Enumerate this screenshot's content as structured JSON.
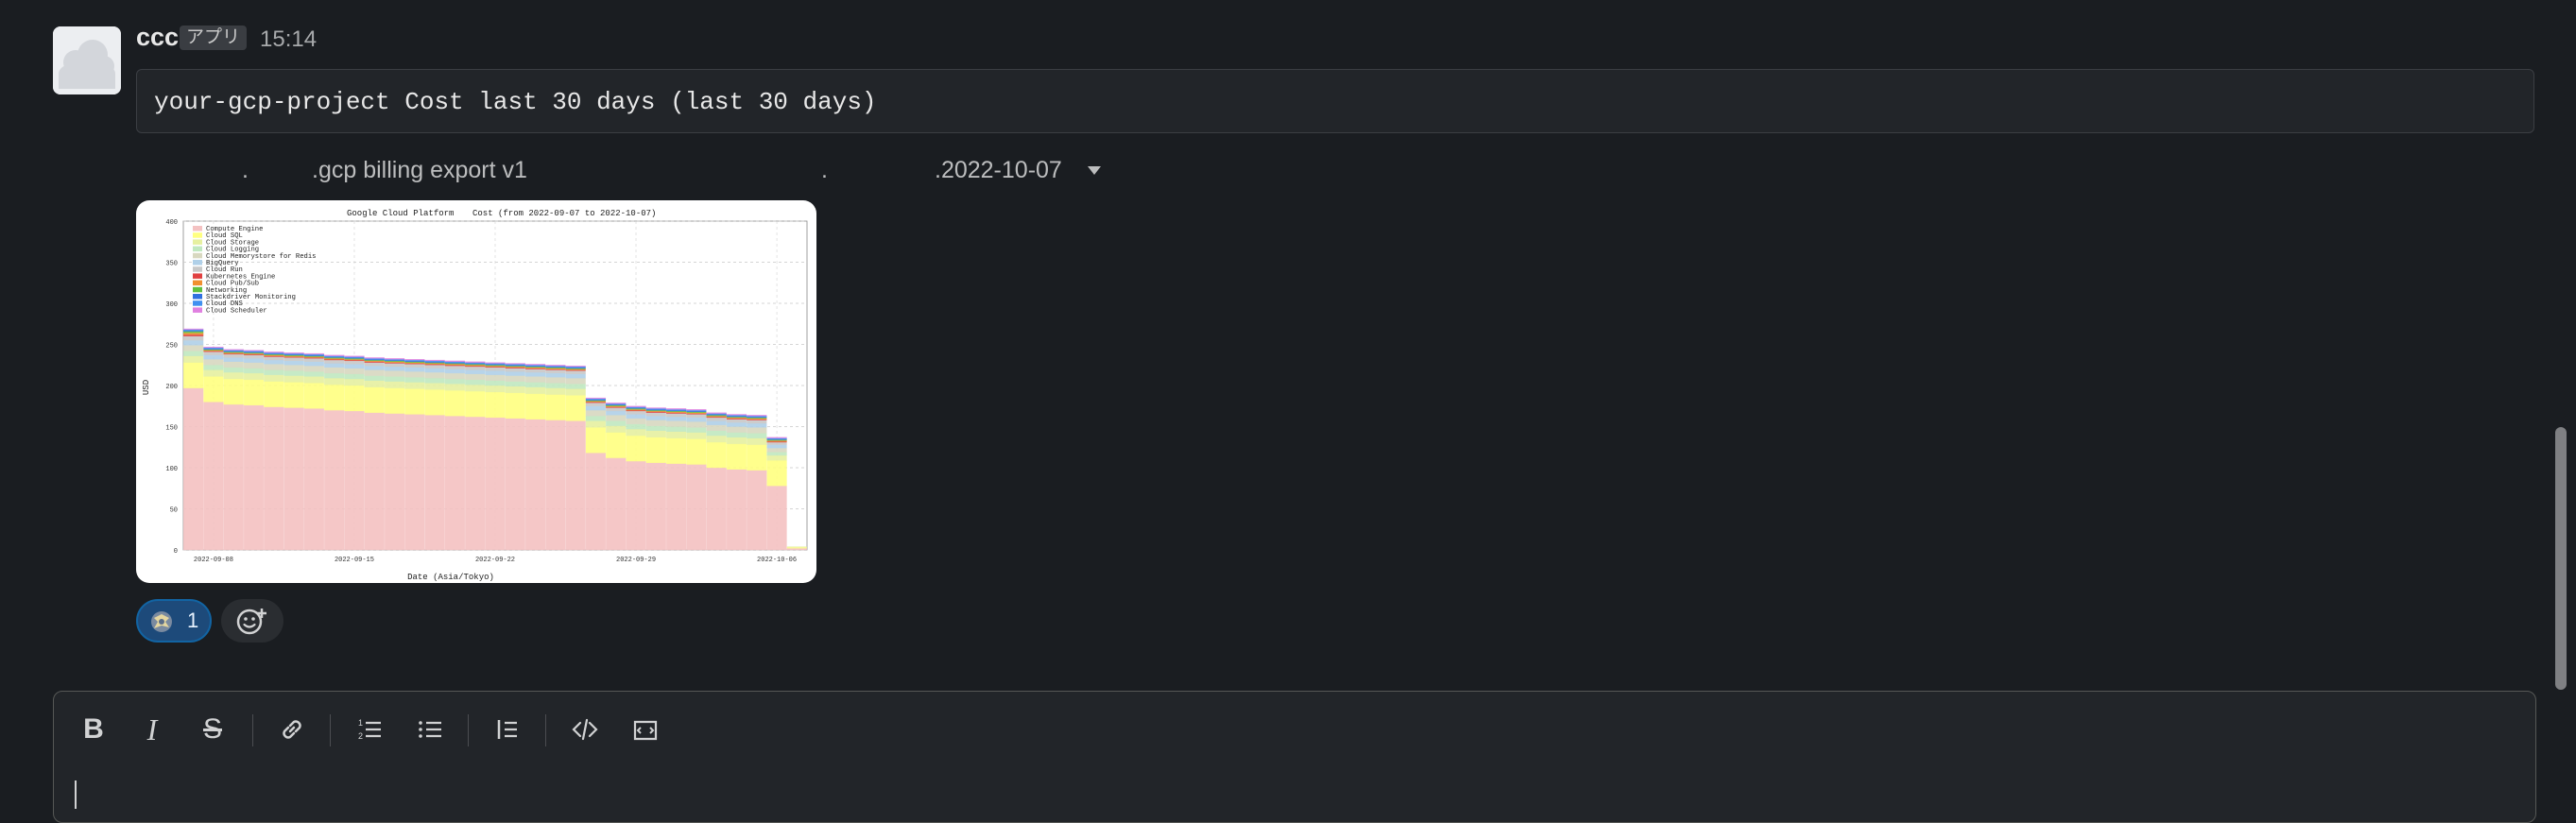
{
  "message": {
    "sender": "ccc",
    "app_badge": "アプリ",
    "time": "15:14",
    "code_text": "your-gcp-project Cost last 30 days (last 30 days)",
    "attachment": {
      "parts": [
        ".",
        ".gcp billing export v1",
        ".",
        ".2022-10-07"
      ],
      "dropdown_icon": "caret-down-icon"
    },
    "reaction": {
      "emoji": "custom-emoji",
      "count": "1"
    },
    "add_reaction_icon": "add-reaction-icon"
  },
  "chart_data": {
    "type": "bar",
    "title": "Google Cloud Platform",
    "subtitle": "Cost (from 2022-09-07 to 2022-10-07)",
    "xlabel": "Date (Asia/Tokyo)",
    "ylabel": "USD",
    "ylim": [
      0,
      400
    ],
    "yticks": [
      0,
      50,
      100,
      150,
      200,
      250,
      300,
      350,
      400
    ],
    "xticks": [
      "2022-09-08",
      "2022-09-15",
      "2022-09-22",
      "2022-09-29",
      "2022-10-06"
    ],
    "legend_position": "top-left",
    "grid": true,
    "categories": [
      "2022-09-07",
      "2022-09-08",
      "2022-09-09",
      "2022-09-10",
      "2022-09-11",
      "2022-09-12",
      "2022-09-13",
      "2022-09-14",
      "2022-09-15",
      "2022-09-16",
      "2022-09-17",
      "2022-09-18",
      "2022-09-19",
      "2022-09-20",
      "2022-09-21",
      "2022-09-22",
      "2022-09-23",
      "2022-09-24",
      "2022-09-25",
      "2022-09-26",
      "2022-09-27",
      "2022-09-28",
      "2022-09-29",
      "2022-09-30",
      "2022-10-01",
      "2022-10-02",
      "2022-10-03",
      "2022-10-04",
      "2022-10-05",
      "2022-10-06",
      "2022-10-07"
    ],
    "series": [
      {
        "name": "Compute Engine",
        "color": "#f4c2c2",
        "values": [
          197,
          180,
          177,
          176,
          174,
          173,
          172,
          170,
          169,
          167,
          166,
          165,
          164,
          163,
          162,
          161,
          160,
          159,
          158,
          157,
          118,
          112,
          108,
          106,
          105,
          104,
          100,
          98,
          97,
          78,
          2
        ]
      },
      {
        "name": "Cloud SQL",
        "color": "#ffff80",
        "values": [
          31,
          31,
          31,
          31,
          31,
          31,
          31,
          31,
          31,
          31,
          31,
          31,
          31,
          31,
          31,
          31,
          31,
          31,
          31,
          31,
          31,
          31,
          31,
          31,
          31,
          31,
          31,
          31,
          31,
          31,
          1
        ]
      },
      {
        "name": "Cloud Storage",
        "color": "#e6f0a0",
        "values": [
          8,
          8,
          8,
          8,
          8,
          8,
          8,
          8,
          8,
          8,
          8,
          8,
          8,
          8,
          8,
          8,
          8,
          8,
          8,
          8,
          8,
          8,
          8,
          8,
          8,
          8,
          8,
          8,
          8,
          6,
          1
        ]
      },
      {
        "name": "Cloud Logging",
        "color": "#c0e8c0",
        "values": [
          6,
          6,
          6,
          6,
          6,
          6,
          6,
          6,
          6,
          6,
          6,
          6,
          6,
          6,
          6,
          6,
          6,
          6,
          6,
          6,
          6,
          6,
          6,
          6,
          6,
          6,
          6,
          6,
          6,
          4,
          0
        ]
      },
      {
        "name": "Cloud Memorystore for Redis",
        "color": "#d8d8c0",
        "values": [
          7,
          7,
          7,
          7,
          7,
          7,
          7,
          7,
          7,
          7,
          7,
          7,
          7,
          7,
          7,
          7,
          7,
          7,
          7,
          7,
          7,
          7,
          7,
          7,
          7,
          7,
          7,
          7,
          7,
          5,
          0
        ]
      },
      {
        "name": "BigQuery",
        "color": "#b0d0e8",
        "values": [
          6,
          5,
          5,
          5,
          5,
          5,
          5,
          5,
          5,
          5,
          5,
          5,
          5,
          5,
          5,
          5,
          5,
          5,
          5,
          5,
          5,
          5,
          5,
          5,
          5,
          5,
          5,
          5,
          5,
          4,
          0
        ]
      },
      {
        "name": "Cloud Run",
        "color": "#c8c8c8",
        "values": [
          5,
          4,
          4,
          4,
          4,
          4,
          4,
          4,
          4,
          4,
          4,
          4,
          4,
          4,
          4,
          4,
          4,
          4,
          4,
          4,
          4,
          4,
          4,
          4,
          4,
          4,
          4,
          4,
          4,
          3,
          0
        ]
      },
      {
        "name": "Kubernetes Engine",
        "color": "#e04040",
        "values": [
          2,
          1,
          1,
          1,
          1,
          1,
          1,
          1,
          1,
          1,
          1,
          1,
          1,
          1,
          1,
          1,
          1,
          1,
          1,
          1,
          1,
          1,
          1,
          1,
          1,
          1,
          1,
          1,
          1,
          1,
          0
        ]
      },
      {
        "name": "Cloud Pub/Sub",
        "color": "#f09030",
        "values": [
          2,
          1,
          1,
          1,
          1,
          1,
          1,
          1,
          1,
          1,
          1,
          1,
          1,
          1,
          1,
          1,
          1,
          1,
          1,
          1,
          1,
          1,
          1,
          1,
          1,
          1,
          1,
          1,
          1,
          1,
          0
        ]
      },
      {
        "name": "Networking",
        "color": "#60c040",
        "values": [
          2,
          1,
          1,
          1,
          1,
          1,
          1,
          1,
          1,
          1,
          1,
          1,
          1,
          1,
          1,
          1,
          1,
          1,
          1,
          1,
          1,
          1,
          1,
          1,
          1,
          1,
          1,
          1,
          1,
          1,
          0
        ]
      },
      {
        "name": "Stackdriver Monitoring",
        "color": "#3070e0",
        "values": [
          1,
          1,
          1,
          1,
          1,
          1,
          1,
          1,
          1,
          1,
          1,
          1,
          1,
          1,
          1,
          1,
          1,
          1,
          1,
          1,
          1,
          1,
          1,
          1,
          1,
          1,
          1,
          1,
          1,
          1,
          0
        ]
      },
      {
        "name": "Cloud DNS",
        "color": "#4090f0",
        "values": [
          1,
          1,
          1,
          1,
          1,
          1,
          1,
          1,
          1,
          1,
          1,
          1,
          1,
          1,
          1,
          1,
          1,
          1,
          1,
          1,
          1,
          1,
          1,
          1,
          1,
          1,
          1,
          1,
          1,
          1,
          0
        ]
      },
      {
        "name": "Cloud Scheduler",
        "color": "#e080e0",
        "values": [
          1,
          1,
          1,
          1,
          1,
          1,
          1,
          1,
          1,
          1,
          1,
          1,
          1,
          1,
          1,
          1,
          1,
          1,
          1,
          1,
          1,
          1,
          1,
          1,
          1,
          1,
          1,
          1,
          1,
          1,
          0
        ]
      }
    ]
  },
  "composer": {
    "toolbar": [
      {
        "name": "bold-icon",
        "label": "B"
      },
      {
        "name": "italic-icon",
        "label": "I"
      },
      {
        "name": "strikethrough-icon",
        "label": "S"
      },
      {
        "name": "link-icon"
      },
      {
        "name": "ordered-list-icon"
      },
      {
        "name": "bulleted-list-icon"
      },
      {
        "name": "blockquote-icon"
      },
      {
        "name": "code-icon"
      },
      {
        "name": "code-block-icon"
      }
    ]
  }
}
